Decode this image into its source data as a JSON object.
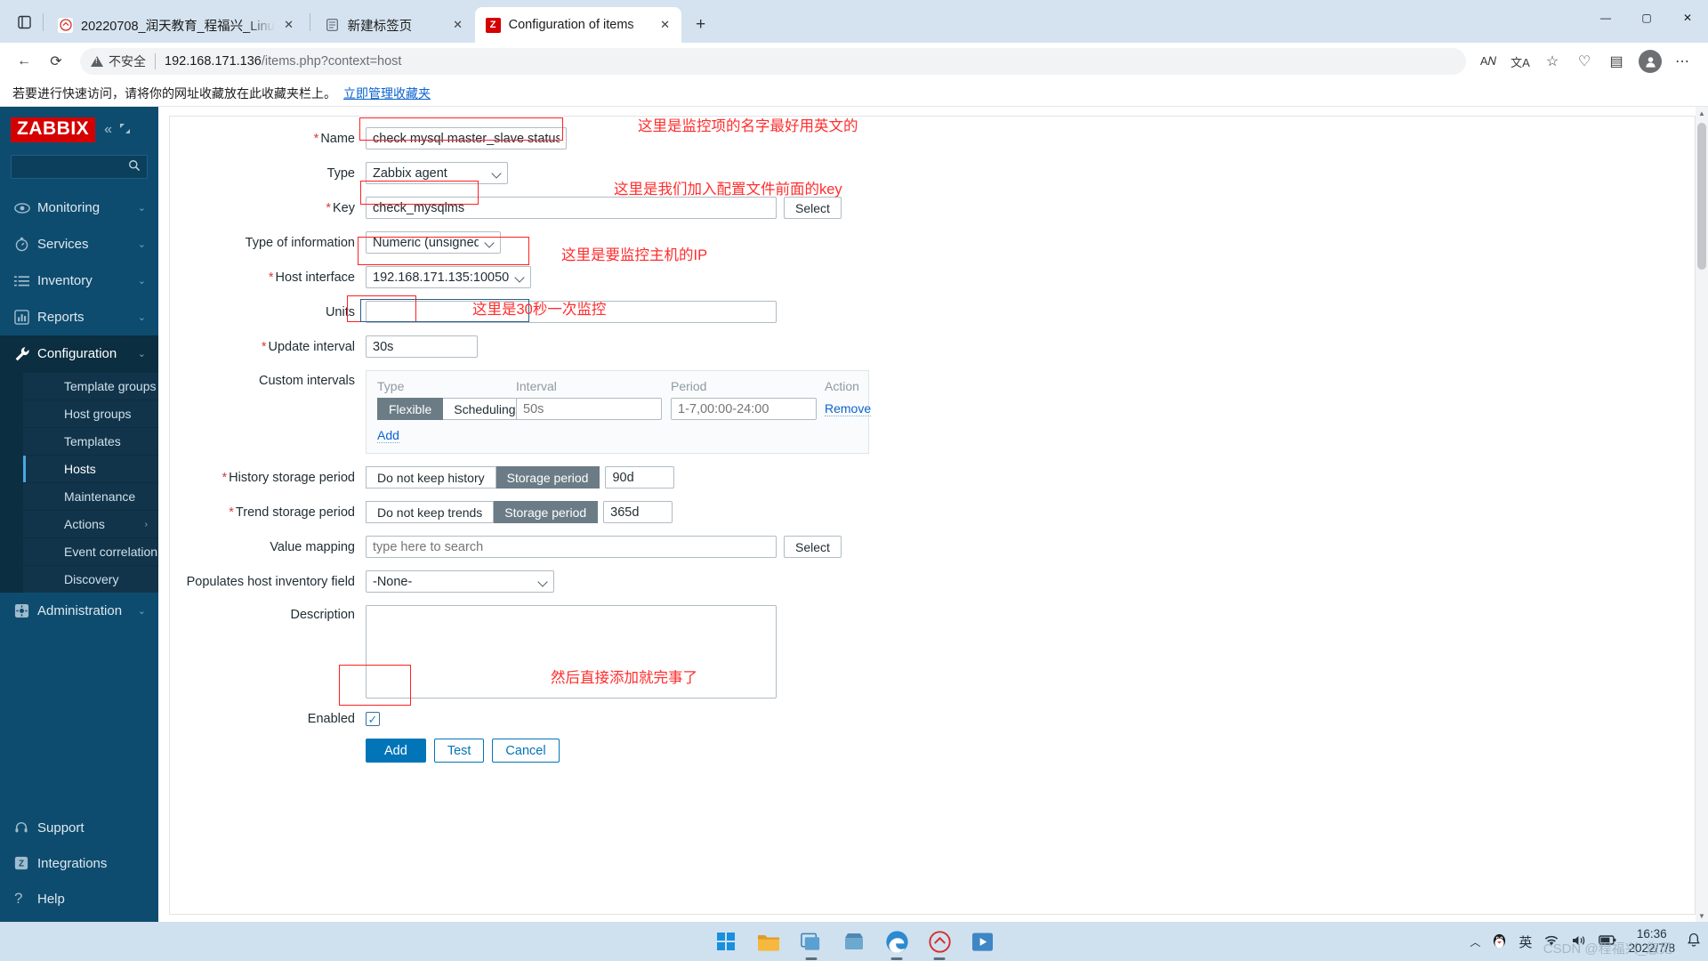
{
  "browser": {
    "tabs": [
      {
        "title": "20220708_润天教育_程福兴_Linu",
        "favicon": "csdn-icon",
        "active": false
      },
      {
        "title": "新建标签页",
        "favicon": "newtab-icon",
        "active": false
      },
      {
        "title": "Configuration of items",
        "favicon": "zabbix-icon",
        "active": true
      }
    ],
    "new_tab_label": "+",
    "close_glyph": "✕",
    "window_controls": {
      "minimize": "—",
      "maximize": "▢",
      "close": "✕"
    },
    "toolbar": {
      "back": "←",
      "reload": "⟳",
      "security_label": "不安全",
      "url_host": "192.168.171.136",
      "url_path": "/items.php?context=host",
      "read_aloud": "A𝑁",
      "translate": "文A",
      "add_favorite": "☆",
      "favorites": "♡",
      "collections": "▤",
      "profile": "👤",
      "settings_more": "⋯"
    },
    "bookmarks_bar": {
      "hint": "若要进行快速访问，请将你的网址收藏放在此收藏夹栏上。",
      "manage_link": "立即管理收藏夹"
    }
  },
  "zabbix": {
    "logo": "ZABBIX",
    "collapse_icon": "«",
    "expand_icon": "⌐",
    "search_icon": "search-icon",
    "nav": [
      {
        "label": "Monitoring",
        "icon": "eye-icon",
        "chevron": "⌄",
        "selected": false
      },
      {
        "label": "Services",
        "icon": "clock-icon",
        "chevron": "⌄",
        "selected": false
      },
      {
        "label": "Inventory",
        "icon": "list-icon",
        "chevron": "⌄",
        "selected": false
      },
      {
        "label": "Reports",
        "icon": "chart-icon",
        "chevron": "⌄",
        "selected": false
      },
      {
        "label": "Configuration",
        "icon": "wrench-icon",
        "chevron": "⌄",
        "selected": true
      }
    ],
    "submenu": [
      {
        "label": "Template groups",
        "active": false,
        "chevron": ""
      },
      {
        "label": "Host groups",
        "active": false,
        "chevron": ""
      },
      {
        "label": "Templates",
        "active": false,
        "chevron": ""
      },
      {
        "label": "Hosts",
        "active": true,
        "chevron": ""
      },
      {
        "label": "Maintenance",
        "active": false,
        "chevron": ""
      },
      {
        "label": "Actions",
        "active": false,
        "chevron": "›"
      },
      {
        "label": "Event correlation",
        "active": false,
        "chevron": ""
      },
      {
        "label": "Discovery",
        "active": false,
        "chevron": ""
      }
    ],
    "admin": {
      "label": "Administration",
      "icon": "gear-icon",
      "chevron": "⌄"
    },
    "bottom_nav": [
      {
        "label": "Support",
        "icon": "headset-icon"
      },
      {
        "label": "Integrations",
        "icon": "zabbix-z-icon"
      },
      {
        "label": "Help",
        "icon": "question-icon"
      }
    ]
  },
  "form": {
    "name": {
      "label": "Name",
      "required": true,
      "value": "check mysql master_slave status"
    },
    "type": {
      "label": "Type",
      "required": false,
      "value": "Zabbix agent"
    },
    "key": {
      "label": "Key",
      "required": true,
      "value": "check_mysqlms",
      "select_button": "Select"
    },
    "type_of_information": {
      "label": "Type of information",
      "required": false,
      "value": "Numeric (unsigned)"
    },
    "host_interface": {
      "label": "Host interface",
      "required": true,
      "value": "192.168.171.135:10050"
    },
    "units": {
      "label": "Units",
      "required": false,
      "value": ""
    },
    "update_interval": {
      "label": "Update interval",
      "required": true,
      "value": "30s"
    },
    "custom_intervals": {
      "label": "Custom intervals",
      "columns": [
        "Type",
        "Interval",
        "Period",
        "Action"
      ],
      "rows": [
        {
          "type_flexible": "Flexible",
          "type_scheduling": "Scheduling",
          "type_selected": "Flexible",
          "interval_placeholder": "50s",
          "interval_value": "",
          "period_placeholder": "1-7,00:00-24:00",
          "period_value": "",
          "action": "Remove"
        }
      ],
      "add_link": "Add"
    },
    "history_storage_period": {
      "label": "History storage period",
      "required": true,
      "option_off": "Do not keep history",
      "option_on": "Storage period",
      "selected": "Storage period",
      "value": "90d"
    },
    "trend_storage_period": {
      "label": "Trend storage period",
      "required": true,
      "option_off": "Do not keep trends",
      "option_on": "Storage period",
      "selected": "Storage period",
      "value": "365d"
    },
    "value_mapping": {
      "label": "Value mapping",
      "placeholder": "type here to search",
      "value": "",
      "select_button": "Select"
    },
    "populates_host_inventory_field": {
      "label": "Populates host inventory field",
      "value": "-None-"
    },
    "description": {
      "label": "Description",
      "value": ""
    },
    "enabled": {
      "label": "Enabled",
      "checked": true,
      "tick": "✓"
    },
    "actions": {
      "add": "Add",
      "test": "Test",
      "cancel": "Cancel"
    }
  },
  "annotations": [
    {
      "id": "name-note",
      "text": "这里是监控项的名字最好用英文的"
    },
    {
      "id": "key-note",
      "text": "这里是我们加入配置文件前面的key"
    },
    {
      "id": "host-interface-note",
      "text": "这里是要监控主机的IP"
    },
    {
      "id": "update-interval-note",
      "text": "这里是30秒一次监控"
    },
    {
      "id": "add-note",
      "text": "然后直接添加就完事了"
    }
  ],
  "taskbar": {
    "items": [
      "start-icon",
      "file-explorer-icon",
      "task-view-icon",
      "store-icon",
      "edge-icon",
      "csdn-icon",
      "media-player-icon"
    ],
    "tray": {
      "chevron_up": "︿",
      "qq_icon": "qq-icon",
      "ime": "英",
      "wifi_icon": "wifi-icon",
      "volume_icon": "volume-icon",
      "battery_icon": "battery-icon",
      "time": "16:36",
      "date": "2022/7/8",
      "notification_icon": "bell-icon"
    },
    "watermark": "CSDN @程福兴_您见"
  }
}
